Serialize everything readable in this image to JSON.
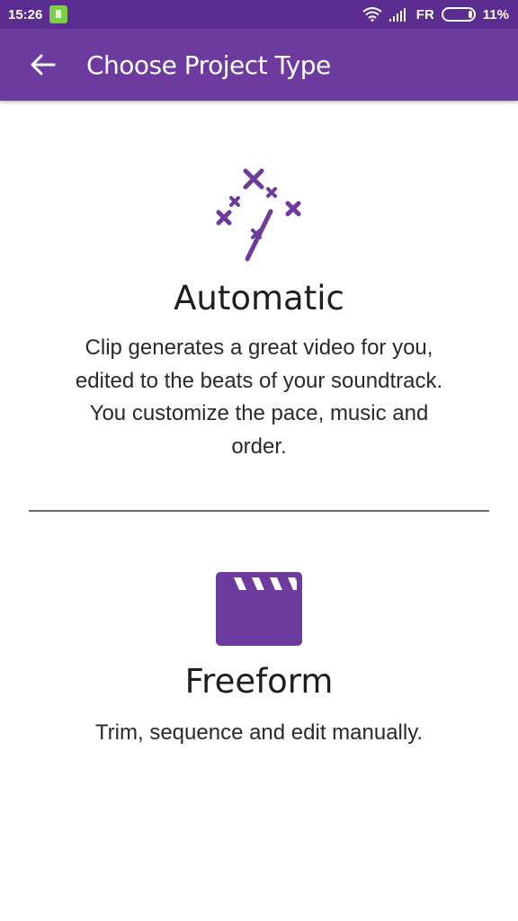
{
  "status_bar": {
    "time": "15:26",
    "carrier": "FR",
    "battery": "11%"
  },
  "app_bar": {
    "title": "Choose Project Type"
  },
  "options": [
    {
      "title": "Automatic",
      "description": "Clip generates a great video for you, edited to the beats of your soundtrack. You customize the pace, music and order.",
      "icon": "magic-wand-icon"
    },
    {
      "title": "Freeform",
      "description": "Trim, sequence and edit manually.",
      "icon": "clapperboard-icon"
    }
  ],
  "colors": {
    "status_bar": "#5c2d91",
    "app_bar": "#6d3a9e",
    "accent": "#6d3a9e"
  }
}
